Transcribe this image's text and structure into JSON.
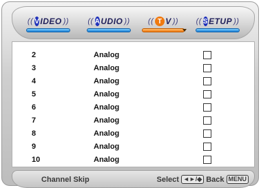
{
  "tabs": [
    {
      "initial": "V",
      "rest": "IDEO",
      "active": false
    },
    {
      "initial": "A",
      "rest": "UDIO",
      "active": false
    },
    {
      "initial": "T",
      "rest": "V",
      "active": true
    },
    {
      "initial": "S",
      "rest": "ETUP",
      "active": false
    }
  ],
  "channels": [
    {
      "number": "2",
      "type": "Analog",
      "skipped": false
    },
    {
      "number": "3",
      "type": "Analog",
      "skipped": false
    },
    {
      "number": "4",
      "type": "Analog",
      "skipped": false
    },
    {
      "number": "5",
      "type": "Analog",
      "skipped": false
    },
    {
      "number": "6",
      "type": "Analog",
      "skipped": false
    },
    {
      "number": "7",
      "type": "Analog",
      "skipped": false
    },
    {
      "number": "8",
      "type": "Analog",
      "skipped": false
    },
    {
      "number": "9",
      "type": "Analog",
      "skipped": false
    },
    {
      "number": "10",
      "type": "Analog",
      "skipped": false
    }
  ],
  "footer": {
    "title": "Channel Skip",
    "select_label": "Select",
    "select_key": "◄►/◆",
    "back_label": "Back",
    "back_key": "MENU"
  },
  "colors": {
    "tab_bar": "#1a7fd6",
    "active_tab_bar": "#f07a10",
    "tab_text": "#20205a"
  }
}
